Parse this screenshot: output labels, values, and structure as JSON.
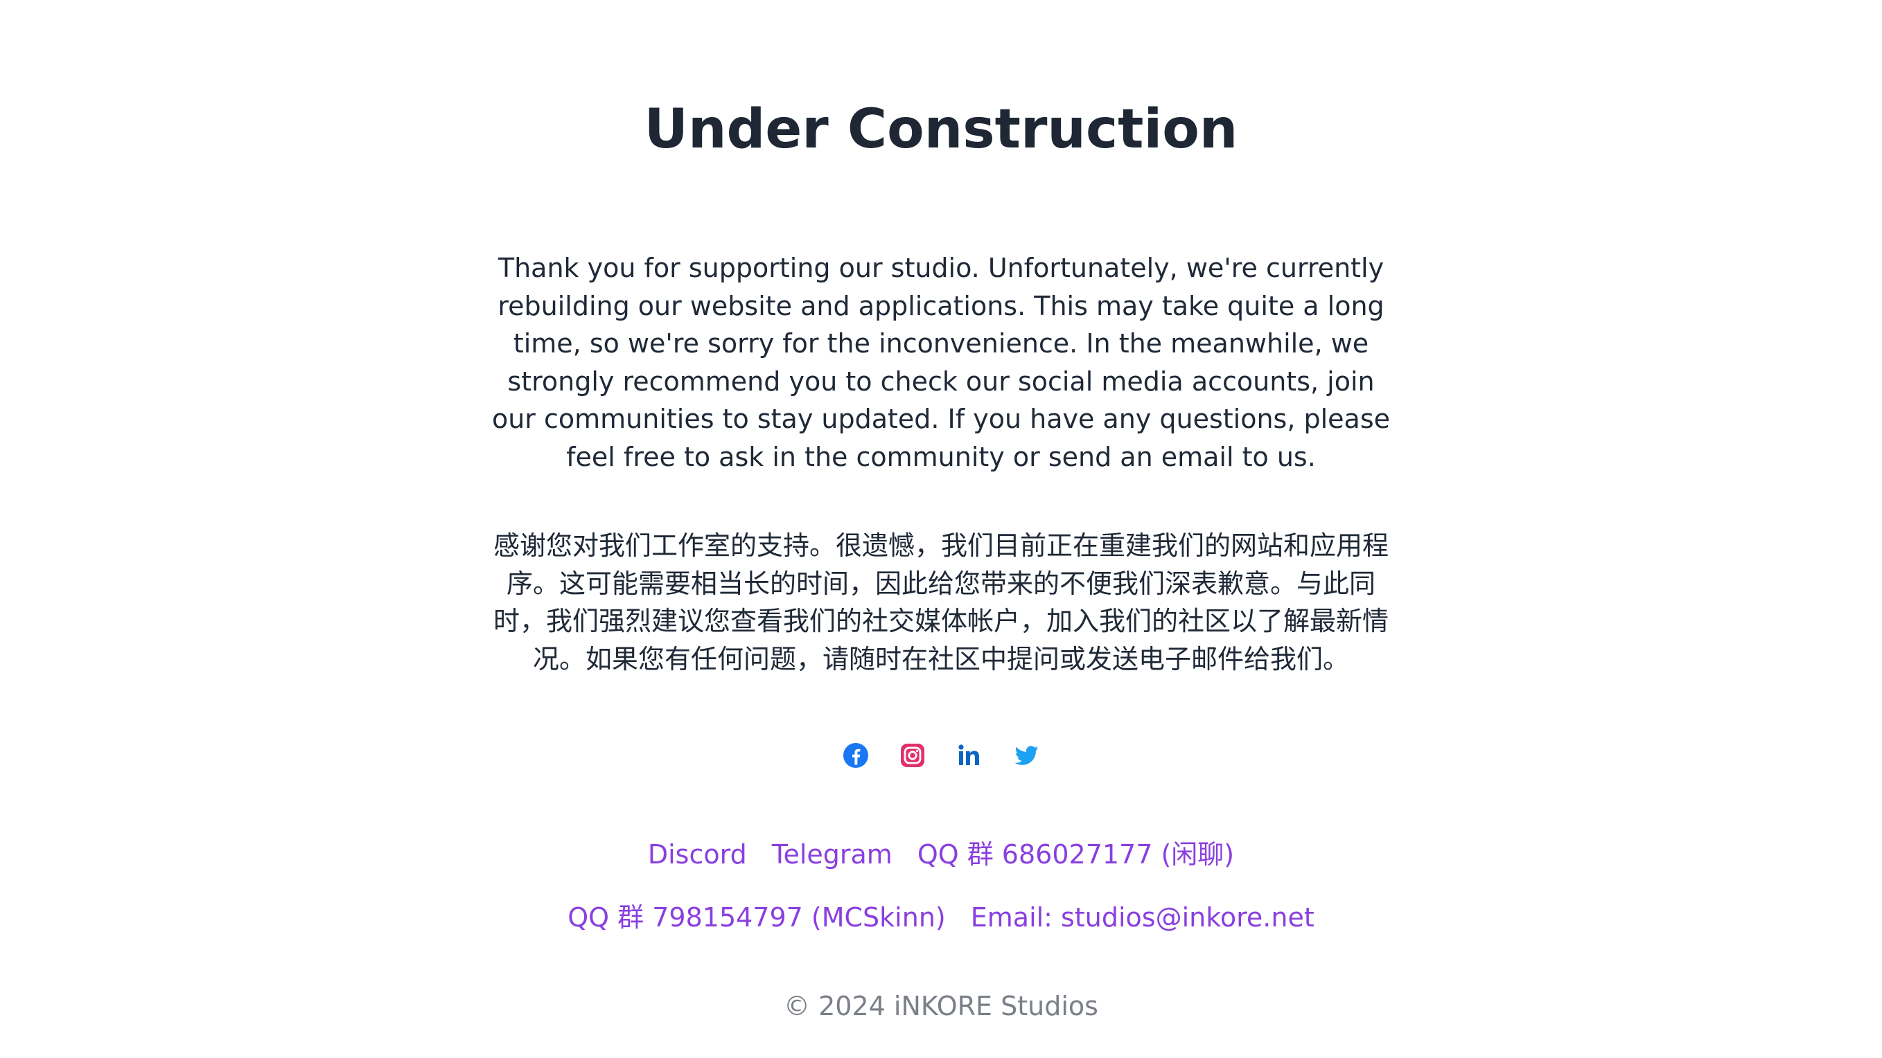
{
  "page": {
    "title": "Under Construction",
    "paragraph_en": "Thank you for supporting our studio. Unfortunately, we're currently rebuilding our website and applications. This may take quite a long time, so we're sorry for the inconvenience. In the meanwhile, we strongly recommend you to check our social media accounts, join our communities to stay updated. If you have any questions, please feel free to ask in the community or send an email to us.",
    "paragraph_zh": "感谢您对我们工作室的支持。很遗憾，我们目前正在重建我们的网站和应用程序。这可能需要相当长的时间，因此给您带来的不便我们深表歉意。与此同时，我们强烈建议您查看我们的社交媒体帐户，加入我们的社区以了解最新情况。如果您有任何问题，请随时在社区中提问或发送电子邮件给我们。"
  },
  "social": [
    {
      "icon": "facebook-icon",
      "color": "#1877f2"
    },
    {
      "icon": "instagram-icon",
      "color": "#e1306c"
    },
    {
      "icon": "linkedin-icon",
      "color": "#0a66c2"
    },
    {
      "icon": "twitter-icon",
      "color": "#1da1f2"
    }
  ],
  "community_links": {
    "row1": [
      "Discord",
      "Telegram",
      "QQ 群 686027177 (闲聊)"
    ],
    "row2": [
      "QQ 群 798154797 (MCSkinn)",
      "Email: studios@inkore.net"
    ]
  },
  "colors": {
    "link": "#8a3fe0",
    "title": "#1e2733",
    "footer": "#7a7f88"
  },
  "footer": {
    "copyright": "© 2024 iNKORE Studios"
  }
}
